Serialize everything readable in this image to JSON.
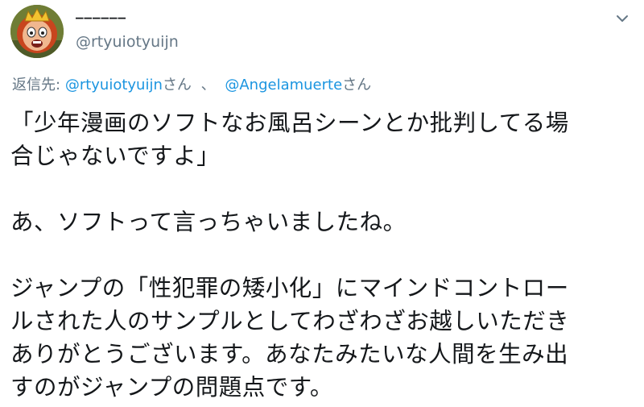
{
  "author": {
    "display_name": "______",
    "handle": "@rtyuiotyuijn",
    "avatar_icon": "cartoon-avatar-icon"
  },
  "menu_icon": "chevron-down-icon",
  "reply_to": {
    "prefix": "返信先:",
    "mentions": [
      {
        "handle": "@rtyuiotyuijn",
        "suffix": "さん"
      },
      {
        "handle": "@Angelamuerte",
        "suffix": "さん"
      }
    ],
    "separator": "、"
  },
  "body": {
    "paragraph1": {
      "line1": "「少年漫画のソフトなお風呂シーンとか批判してる場",
      "line2": "合じゃないですよ」"
    },
    "paragraph2": {
      "line1": "あ、ソフトって言っちゃいましたね。"
    },
    "paragraph3": {
      "line1": "ジャンプの「性犯罪の矮小化」にマインドコントロー",
      "line2": "ルされた人のサンプルとしてわざわざお越しいただき",
      "line3": "ありがとうございます。あなたみたいな人間を生み出",
      "line4": "すのがジャンプの問題点です。"
    }
  },
  "colors": {
    "text": "#14171a",
    "secondary": "#657786",
    "link": "#1b95e0"
  }
}
